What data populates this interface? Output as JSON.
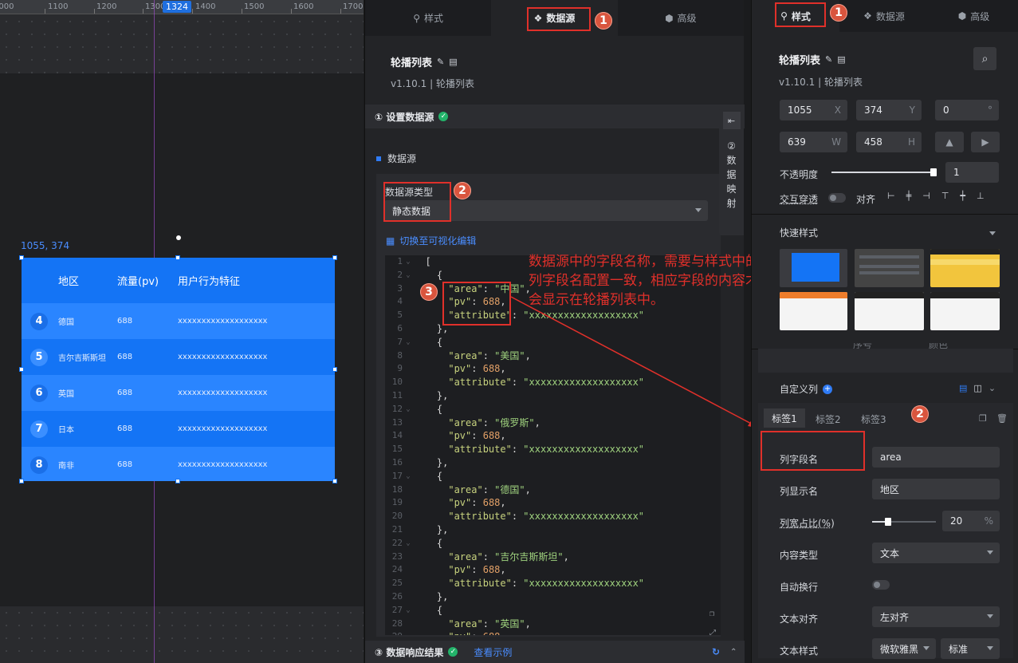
{
  "canvas": {
    "ruler_ticks": [
      "1000",
      "1100",
      "1200",
      "1300",
      "1400",
      "1500",
      "1600",
      "1700"
    ],
    "ruler_marker": "1324",
    "selection_coords": "1055, 374"
  },
  "carousel": {
    "headers": [
      "地区",
      "流量(pv)",
      "用户行为特征"
    ],
    "rows": [
      {
        "num": "4",
        "area": "德国",
        "pv": "688",
        "attr": "xxxxxxxxxxxxxxxxxxx"
      },
      {
        "num": "5",
        "area": "吉尔吉斯斯坦",
        "pv": "688",
        "attr": "xxxxxxxxxxxxxxxxxxx"
      },
      {
        "num": "6",
        "area": "英国",
        "pv": "688",
        "attr": "xxxxxxxxxxxxxxxxxxx"
      },
      {
        "num": "7",
        "area": "日本",
        "pv": "688",
        "attr": "xxxxxxxxxxxxxxxxxxx"
      },
      {
        "num": "8",
        "area": "南非",
        "pv": "688",
        "attr": "xxxxxxxxxxxxxxxxxxx"
      }
    ],
    "colors": {
      "bg": "#1474f5",
      "alt": "#2a85ff"
    }
  },
  "mid": {
    "tabs": [
      {
        "label": "样式"
      },
      {
        "label": "数据源"
      },
      {
        "label": "高级"
      }
    ],
    "component_title": "轮播列表",
    "component_version": "v1.10.1 | 轮播列表",
    "section1": "① 设置数据源",
    "datasource_heading": "数据源",
    "datasource_type_label": "数据源类型",
    "datasource_type_value": "静态数据",
    "switch_link": "切换至可视化编辑",
    "side_tab": "② 数 据 映 射",
    "section3": "③ 数据响应结果",
    "view_example": "查看示例",
    "badges": [
      "1",
      "2",
      "3"
    ],
    "annotation": "数据源中的字段名称，需要与样式中的列字段名配置一致，相应字段的内容才会显示在轮播列表中。"
  },
  "code_lines": [
    {
      "n": "1",
      "fold": "⌄",
      "t": "  ["
    },
    {
      "n": "2",
      "fold": "⌄",
      "t": "    {"
    },
    {
      "n": "3",
      "fold": "",
      "t": "      \"area\": \"中国\","
    },
    {
      "n": "4",
      "fold": "",
      "t": "      \"pv\": 688,"
    },
    {
      "n": "5",
      "fold": "",
      "t": "      \"attribute\": \"xxxxxxxxxxxxxxxxxxx\""
    },
    {
      "n": "6",
      "fold": "",
      "t": "    },"
    },
    {
      "n": "7",
      "fold": "⌄",
      "t": "    {"
    },
    {
      "n": "8",
      "fold": "",
      "t": "      \"area\": \"美国\","
    },
    {
      "n": "9",
      "fold": "",
      "t": "      \"pv\": 688,"
    },
    {
      "n": "10",
      "fold": "",
      "t": "      \"attribute\": \"xxxxxxxxxxxxxxxxxxx\""
    },
    {
      "n": "11",
      "fold": "",
      "t": "    },"
    },
    {
      "n": "12",
      "fold": "⌄",
      "t": "    {"
    },
    {
      "n": "13",
      "fold": "",
      "t": "      \"area\": \"俄罗斯\","
    },
    {
      "n": "14",
      "fold": "",
      "t": "      \"pv\": 688,"
    },
    {
      "n": "15",
      "fold": "",
      "t": "      \"attribute\": \"xxxxxxxxxxxxxxxxxxx\""
    },
    {
      "n": "16",
      "fold": "",
      "t": "    },"
    },
    {
      "n": "17",
      "fold": "⌄",
      "t": "    {"
    },
    {
      "n": "18",
      "fold": "",
      "t": "      \"area\": \"德国\","
    },
    {
      "n": "19",
      "fold": "",
      "t": "      \"pv\": 688,"
    },
    {
      "n": "20",
      "fold": "",
      "t": "      \"attribute\": \"xxxxxxxxxxxxxxxxxxx\""
    },
    {
      "n": "21",
      "fold": "",
      "t": "    },"
    },
    {
      "n": "22",
      "fold": "⌄",
      "t": "    {"
    },
    {
      "n": "23",
      "fold": "",
      "t": "      \"area\": \"吉尔吉斯斯坦\","
    },
    {
      "n": "24",
      "fold": "",
      "t": "      \"pv\": 688,"
    },
    {
      "n": "25",
      "fold": "",
      "t": "      \"attribute\": \"xxxxxxxxxxxxxxxxxxx\""
    },
    {
      "n": "26",
      "fold": "",
      "t": "    },"
    },
    {
      "n": "27",
      "fold": "⌄",
      "t": "    {"
    },
    {
      "n": "28",
      "fold": "",
      "t": "      \"area\": \"英国\","
    },
    {
      "n": "29",
      "fold": "",
      "t": "      \"pv\": 688,"
    }
  ],
  "right": {
    "tabs": [
      {
        "label": "样式"
      },
      {
        "label": "数据源"
      },
      {
        "label": "高级"
      }
    ],
    "component_title": "轮播列表",
    "component_version": "v1.10.1 | 轮播列表",
    "x": "1055",
    "x_suffix": "X",
    "y": "374",
    "y_suffix": "Y",
    "rotation": "0",
    "rotation_suffix": "°",
    "w": "639",
    "w_suffix": "W",
    "h": "458",
    "h_suffix": "H",
    "opacity_label": "不透明度",
    "opacity_value": "1",
    "opacity_fraction": 1.0,
    "interact_label": "交互穿透",
    "align_label": "对齐",
    "quick_style_label": "快速样式",
    "custom_col_label": "自定义列",
    "col_tabs": [
      "标签1",
      "标签2",
      "标签3"
    ],
    "field_label": "列字段名",
    "field_value": "area",
    "display_label": "列显示名",
    "display_value": "地区",
    "width_label": "列宽占比(%)",
    "width_value": "20",
    "width_suffix": "%",
    "width_fraction": 0.2,
    "content_type_label": "内容类型",
    "content_type_value": "文本",
    "wrap_label": "自动换行",
    "text_align_label": "文本对齐",
    "text_align_value": "左对齐",
    "text_style_label": "文本样式",
    "text_font_value": "微软雅黑",
    "text_weight_value": "标准",
    "partial_labels": [
      "序号",
      "颜色"
    ],
    "badges": [
      "1",
      "2"
    ]
  }
}
